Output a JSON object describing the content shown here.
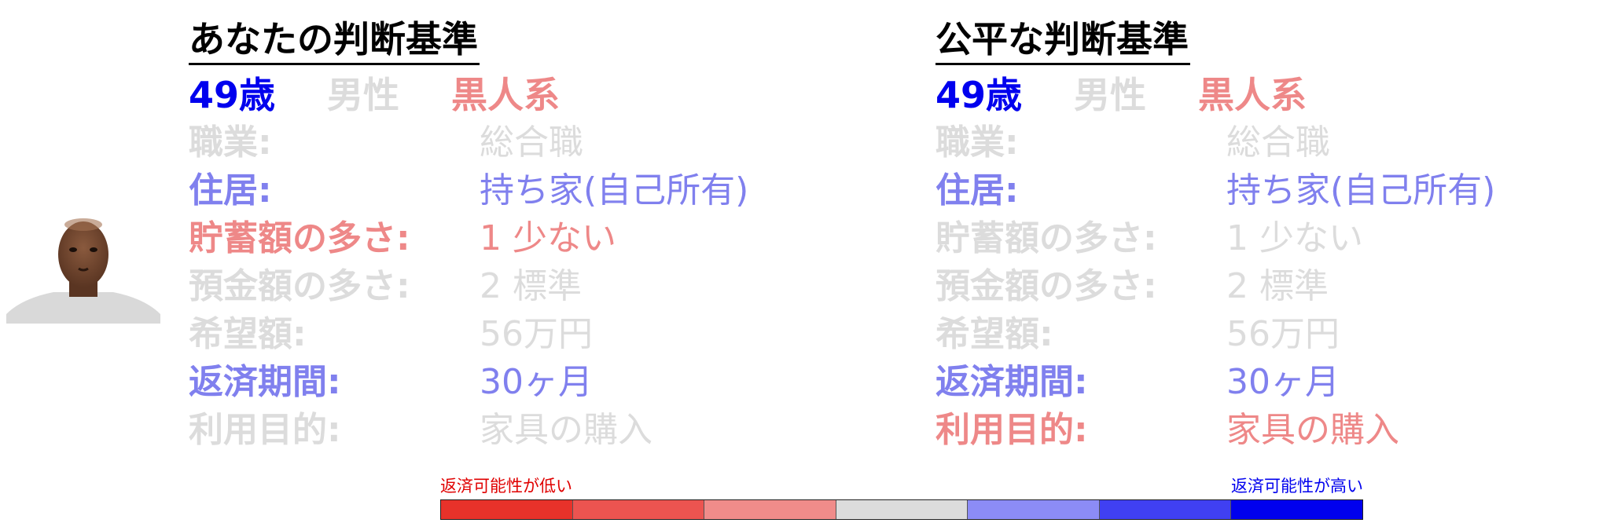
{
  "colors": {
    "neutral": "#dcdcdc",
    "blue_strong": "#0000ee",
    "blue_light": "#8080ee",
    "red_light": "#ee8888",
    "red_text": "#e00000",
    "blue_text": "#0000ee",
    "scale": [
      "#e8322a",
      "#ec5450",
      "#f08c8a",
      "#dcdcdc",
      "#8c8cf6",
      "#4040f2",
      "#0000ee"
    ]
  },
  "left": {
    "title": "あなたの判断基準",
    "demo": {
      "age": "49歳",
      "sex": "男性",
      "race": "黒人系"
    },
    "rows": [
      {
        "label": "職業:",
        "value": "総合職"
      },
      {
        "label": "住居:",
        "value": "持ち家(自己所有)"
      },
      {
        "label": "貯蓄額の多さ:",
        "value": "1 少ない"
      },
      {
        "label": "預金額の多さ:",
        "value": "2 標準"
      },
      {
        "label": "希望額:",
        "value": "56万円"
      },
      {
        "label": "返済期間:",
        "value": "30ヶ月"
      },
      {
        "label": "利用目的:",
        "value": "家具の購入"
      }
    ]
  },
  "right": {
    "title": "公平な判断基準",
    "demo": {
      "age": "49歳",
      "sex": "男性",
      "race": "黒人系"
    },
    "rows": [
      {
        "label": "職業:",
        "value": "総合職"
      },
      {
        "label": "住居:",
        "value": "持ち家(自己所有)"
      },
      {
        "label": "貯蓄額の多さ:",
        "value": "1 少ない"
      },
      {
        "label": "預金額の多さ:",
        "value": "2 標準"
      },
      {
        "label": "希望額:",
        "value": "56万円"
      },
      {
        "label": "返済期間:",
        "value": "30ヶ月"
      },
      {
        "label": "利用目的:",
        "value": "家具の購入"
      }
    ]
  },
  "scale": {
    "low_label": "返済可能性が低い",
    "high_label": "返済可能性が高い"
  },
  "avatar_icon": "person-photo"
}
